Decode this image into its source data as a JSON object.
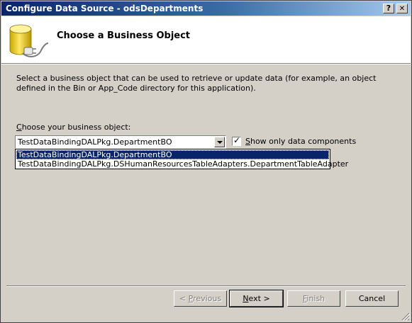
{
  "window": {
    "title": "Configure Data Source - odsDepartments",
    "help_glyph": "?",
    "close_glyph": "✕"
  },
  "header": {
    "title": "Choose a Business Object",
    "icon": "database-plug-icon"
  },
  "description": "Select a business object that can be used to retrieve or update data (for example, an object defined in the Bin or App_Code directory for this application).",
  "business_object": {
    "label": "Choose your business object:",
    "selected_value": "TestDataBindingDALPkg.DepartmentBO",
    "options": [
      "TestDataBindingDALPkg.DepartmentBO",
      "TestDataBindingDALPkg.DSHumanResourcesTableAdapters.DepartmentTableAdapter"
    ]
  },
  "show_only_data_components": {
    "label": "Show only data components",
    "checked": true
  },
  "buttons": {
    "previous": "< Previous",
    "next": "Next >",
    "finish": "Finish",
    "cancel": "Cancel"
  },
  "colors": {
    "titlebar_start": "#0a246a",
    "titlebar_end": "#a6caf0",
    "face": "#d4d0c8",
    "selection": "#0a246a"
  }
}
